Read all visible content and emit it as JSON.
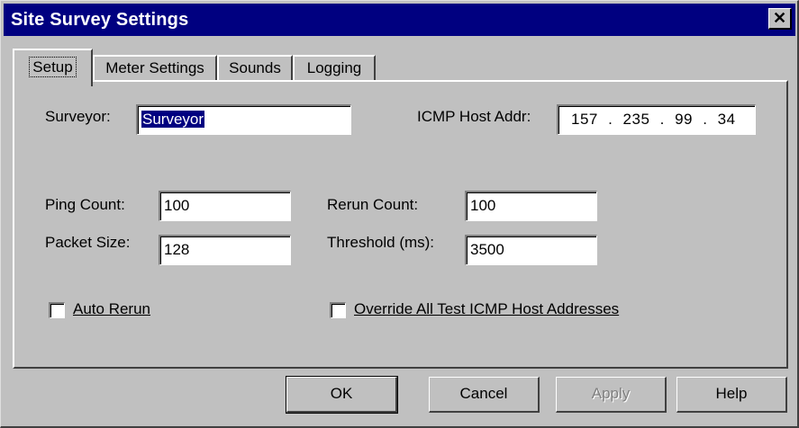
{
  "window": {
    "title": "Site Survey Settings",
    "close_glyph": "✕"
  },
  "tabs": [
    {
      "label": "Setup",
      "active": true
    },
    {
      "label": "Meter Settings",
      "active": false
    },
    {
      "label": "Sounds",
      "active": false
    },
    {
      "label": "Logging",
      "active": false
    }
  ],
  "setup": {
    "surveyor_label": "Surveyor:",
    "surveyor_value": "Surveyor",
    "icmp_label": "ICMP Host Addr:",
    "icmp_value": "157 . 235 .  99  .  34",
    "ping_count_label": "Ping Count:",
    "ping_count_value": "100",
    "packet_size_label": "Packet Size:",
    "packet_size_value": "128",
    "rerun_count_label": "Rerun Count:",
    "rerun_count_value": "100",
    "threshold_label": "Threshold (ms):",
    "threshold_value": "3500",
    "auto_rerun_label": "Auto Rerun",
    "auto_rerun_checked": false,
    "override_label": "Override All Test ICMP Host Addresses",
    "override_checked": false
  },
  "buttons": {
    "ok": "OK",
    "cancel": "Cancel",
    "apply": "Apply",
    "help": "Help"
  },
  "colors": {
    "titlebar": "#000080",
    "face": "#c0c0c0",
    "selection": "#000080"
  }
}
